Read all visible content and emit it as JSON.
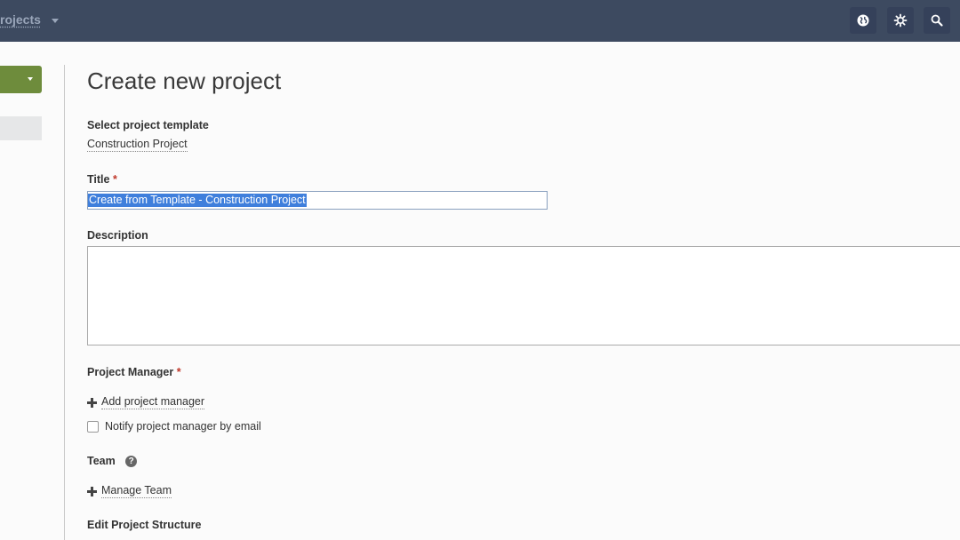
{
  "topbar": {
    "title": "rojects",
    "icons": [
      "globe-icon",
      "gear-icon",
      "search-icon"
    ]
  },
  "page": {
    "title": "Create new project"
  },
  "form": {
    "template_label": "Select project template",
    "template_value": "Construction Project",
    "title_label": "Title",
    "title_required": "*",
    "title_value": "Create from Template - Construction Project",
    "description_label": "Description",
    "description_value": "",
    "pm_label": "Project Manager",
    "pm_required": "*",
    "add_pm_label": "Add project manager",
    "notify_label": "Notify project manager by email",
    "notify_checked": false,
    "team_label": "Team",
    "team_help": "?",
    "manage_team_label": "Manage Team",
    "edit_structure_label": "Edit Project Structure"
  },
  "colors": {
    "topbar": "#3d4a60",
    "primary_button": "#6e8c3c",
    "selection": "#3f7fdc",
    "required": "#c0392b"
  }
}
